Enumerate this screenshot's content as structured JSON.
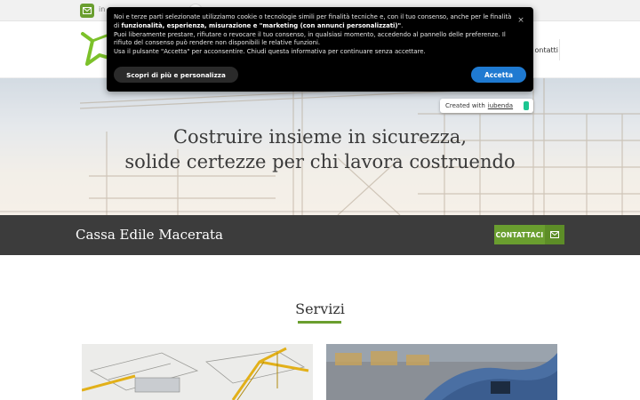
{
  "topbar": {
    "email_text": "in",
    "colors": {
      "green": "#6a9e2f"
    }
  },
  "nav": {
    "last_item": "ontatti"
  },
  "hero": {
    "line1": "Costruire insieme in sicurezza,",
    "line2": "solide certezze per chi lavora costruendo"
  },
  "band": {
    "title": "Cassa Edile Macerata",
    "contact_label": "CONTATTACI"
  },
  "services": {
    "title": "Servizi"
  },
  "cookie": {
    "p1_a": "Noi e terze parti selezionate utilizziamo cookie o tecnologie simili per finalità tecniche e, con il tuo consenso, anche per le finalità di ",
    "p1_b": "funzionalità, esperienza, misurazione e \"marketing (con annunci personalizzati)\"",
    "p1_c": ".",
    "p2": "Puoi liberamente prestare, rifiutare o revocare il tuo consenso, in qualsiasi momento, accedendo al pannello delle preferenze. Il rifiuto del consenso può rendere non disponibili le relative funzioni.",
    "p3": "Usa il pulsante \"Accetta\" per acconsentire. Chiudi questa informativa per continuare senza accettare.",
    "more_label": "Scopri di più e personalizza",
    "accept_label": "Accetta",
    "close_label": "×"
  },
  "badge": {
    "prefix": "Created with",
    "link": "iubenda"
  },
  "icons": [
    "mail-icon",
    "logo-icon",
    "envelope-icon",
    "close-icon",
    "iubenda-mark-icon"
  ]
}
